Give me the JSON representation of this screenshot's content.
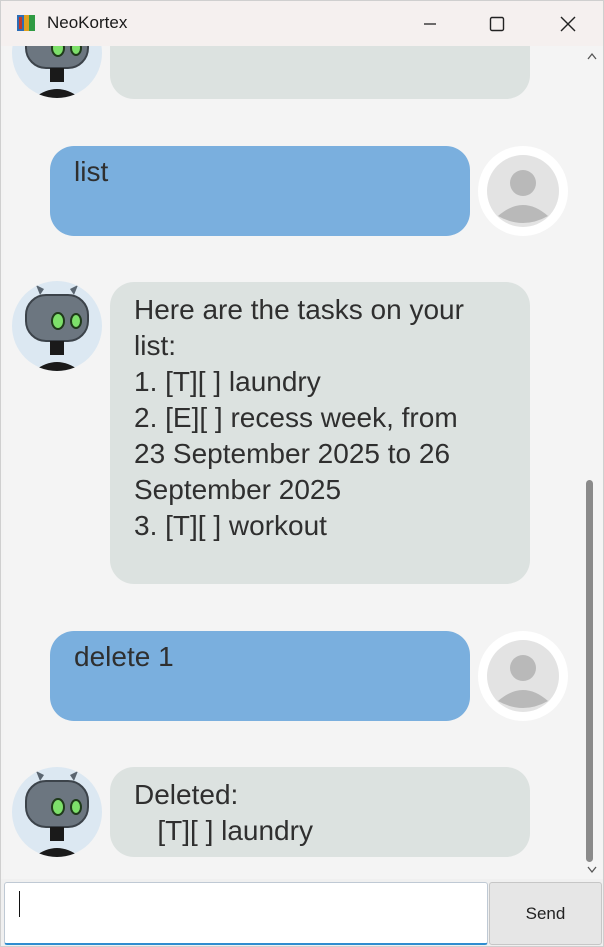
{
  "window": {
    "title": "NeoKortex",
    "icon": "neokortex-app-icon"
  },
  "chat": {
    "messages": [
      {
        "sender": "bot",
        "text": "",
        "partial": true
      },
      {
        "sender": "user",
        "text": "list"
      },
      {
        "sender": "bot",
        "text": "Here are the tasks on your\nlist:\n1. [T][ ] laundry\n2. [E][ ] recess week, from\n23 September 2025 to 26\nSeptember 2025\n3. [T][ ] workout"
      },
      {
        "sender": "user",
        "text": "delete 1"
      },
      {
        "sender": "bot",
        "text": "Deleted:\n   [T][ ] laundry"
      }
    ]
  },
  "input": {
    "value": "",
    "send_label": "Send"
  },
  "colors": {
    "bot_bubble": "#dce2e0",
    "user_bubble": "#7aafde",
    "bot_avatar_bg": "#dce8f2"
  }
}
